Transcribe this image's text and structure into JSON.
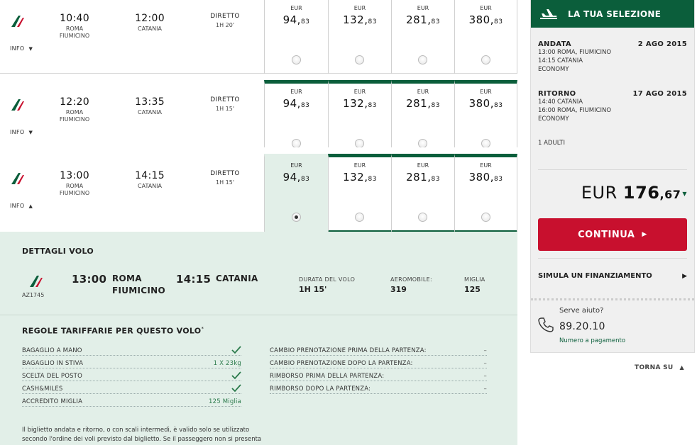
{
  "flights": [
    {
      "dep_time": "10:40",
      "dep_city": "ROMA",
      "dep_airport": "FIUMICINO",
      "arr_time": "12:00",
      "arr_city": "CATANIA",
      "type": "DIRETTO",
      "duration": "1H 20'",
      "info": "INFO",
      "info_arrow": "▼",
      "fares": [
        {
          "cur": "EUR",
          "int": "94,",
          "dec": "83"
        },
        {
          "cur": "EUR",
          "int": "132,",
          "dec": "83"
        },
        {
          "cur": "EUR",
          "int": "281,",
          "dec": "83"
        },
        {
          "cur": "EUR",
          "int": "380,",
          "dec": "83"
        }
      ]
    },
    {
      "dep_time": "12:20",
      "dep_city": "ROMA",
      "dep_airport": "FIUMICINO",
      "arr_time": "13:35",
      "arr_city": "CATANIA",
      "type": "DIRETTO",
      "duration": "1H 15'",
      "info": "INFO",
      "info_arrow": "▼",
      "fares": [
        {
          "cur": "EUR",
          "int": "94,",
          "dec": "83"
        },
        {
          "cur": "EUR",
          "int": "132,",
          "dec": "83"
        },
        {
          "cur": "EUR",
          "int": "281,",
          "dec": "83"
        },
        {
          "cur": "EUR",
          "int": "380,",
          "dec": "83"
        }
      ]
    },
    {
      "dep_time": "13:00",
      "dep_city": "ROMA",
      "dep_airport": "FIUMICINO",
      "arr_time": "14:15",
      "arr_city": "CATANIA",
      "type": "DIRETTO",
      "duration": "1H 15'",
      "info": "INFO",
      "info_arrow": "▲",
      "fares": [
        {
          "cur": "EUR",
          "int": "94,",
          "dec": "83"
        },
        {
          "cur": "EUR",
          "int": "132,",
          "dec": "83"
        },
        {
          "cur": "EUR",
          "int": "281,",
          "dec": "83"
        },
        {
          "cur": "EUR",
          "int": "380,",
          "dec": "83"
        }
      ]
    }
  ],
  "details": {
    "title": "DETTAGLI VOLO",
    "flight_code": "AZ1745",
    "dep_time": "13:00",
    "dep_city": "ROMA",
    "dep_airport": "FIUMICINO",
    "arr_time": "14:15",
    "arr_city": "CATANIA",
    "duration_label": "DURATA DEL VOLO",
    "duration_value": "1H 15'",
    "aircraft_label": "AEROMOBILE:",
    "aircraft_value": "319",
    "miles_label": "MIGLIA",
    "miles_value": "125"
  },
  "rules": {
    "title": "REGOLE TARIFFARIE PER QUESTO VOLO",
    "title_mark": "*",
    "left": [
      {
        "label": "BAGAGLIO A MANO",
        "value": "",
        "check": true
      },
      {
        "label": "BAGAGLIO IN STIVA",
        "value": "1 X 23kg",
        "check": false
      },
      {
        "label": "SCELTA DEL POSTO",
        "value": "",
        "check": true
      },
      {
        "label": "CASH&MILES",
        "value": "",
        "check": true
      },
      {
        "label": "ACCREDITO MIGLIA",
        "value": "125 Miglia",
        "check": false
      }
    ],
    "right": [
      {
        "label": "CAMBIO PRENOTAZIONE PRIMA DELLA PARTENZA:",
        "value": "–"
      },
      {
        "label": "CAMBIO PRENOTAZIONE DOPO LA PARTENZA:",
        "value": "–"
      },
      {
        "label": "RIMBORSO PRIMA DELLA PARTENZA:",
        "value": "–"
      },
      {
        "label": "RIMBORSO DOPO LA PARTENZA:",
        "value": "–"
      }
    ],
    "note_line1": "Il biglietto andata e ritorno, o con scali intermedi, è valido solo se utilizzato",
    "note_line2": "secondo l'ordine dei voli previsto dal biglietto. Se il passeggero non si presenta"
  },
  "sidebar": {
    "title": "LA TUA SELEZIONE",
    "outbound": {
      "label": "ANDATA",
      "date": "2 AGO 2015",
      "t1": "13:00",
      "c1": "ROMA, FIUMICINO",
      "t2": "14:15",
      "c2": "CATANIA",
      "cabin": "ECONOMY"
    },
    "return": {
      "label": "RITORNO",
      "date": "17 AGO 2015",
      "t1": "14:40",
      "c1": "CATANIA",
      "t2": "16:00",
      "c2": "ROMA, FIUMICINO",
      "cabin": "ECONOMY"
    },
    "passengers": "1 ADULTI",
    "total_currency": "EUR",
    "total_int": "176",
    "total_dec": ",67",
    "continue_label": "CONTINUA",
    "financing_label": "SIMULA UN FINANZIAMENTO",
    "help_question": "Serve aiuto?",
    "help_number": "89.20.10",
    "help_note": "Numero a pagamento"
  },
  "back_to_top": "TORNA SU",
  "colors": {
    "brand_green": "#0b5e3b",
    "cta_red": "#c8102e",
    "selected_bg": "#e2efe8"
  },
  "selection": {
    "selected_flight_index": 2,
    "selected_fare_index": 0
  }
}
